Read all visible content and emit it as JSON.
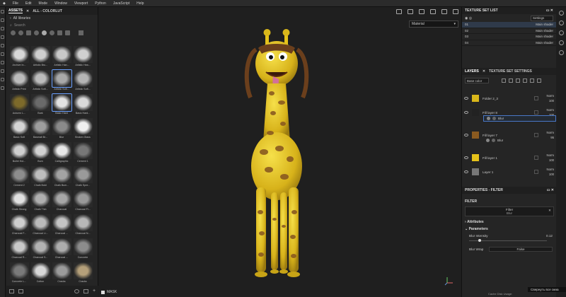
{
  "menu": [
    "File",
    "Edit",
    "Mode",
    "Window",
    "Viewport",
    "Python",
    "JavaScript",
    "Help"
  ],
  "assets": {
    "tab_assets": "ASSETS",
    "tab_close": "✕",
    "tab_colorlut": "ALL - COLORLUT",
    "library": "All libraries",
    "search_placeholder": "Search",
    "items": [
      {
        "label": "Archive In...",
        "sw": "#d8d8d8"
      },
      {
        "label": "Artistic Bru...",
        "sw": "#cfcfcf"
      },
      {
        "label": "Artistic Han...",
        "sw": "#c8c8c8"
      },
      {
        "label": "Artistic Hea...",
        "sw": "#d0d0d0"
      },
      {
        "label": "Artistic Print",
        "sw": "#bdbdbd"
      },
      {
        "label": "Artistic Soft...",
        "sw": "#bcbcbc"
      },
      {
        "label": "Artistic Soft...",
        "sw": "#a9a9a9",
        "sel": true
      },
      {
        "label": "Artistic Soft...",
        "sw": "#b5b5b5"
      },
      {
        "label": "Autumn L...",
        "sw": "#7d6a2a"
      },
      {
        "label": "Bark",
        "sw": "#6a6a6a"
      },
      {
        "label": "Basic Hard",
        "sw": "#e2e2e2",
        "sel": true
      },
      {
        "label": "Basic Hard...",
        "sw": "#d9d9d9"
      },
      {
        "label": "Basic Soft",
        "sw": "#d4d4d4"
      },
      {
        "label": "Basmati Br...",
        "sw": "#9e9e9e"
      },
      {
        "label": "Blur",
        "sw": "#8a8a8a"
      },
      {
        "label": "Broken Glass",
        "sw": "#efefef"
      },
      {
        "label": "Bullet Hol...",
        "sw": "#cfcfcf"
      },
      {
        "label": "Burn",
        "sw": "#d2d2d2"
      },
      {
        "label": "Calligraphic",
        "sw": "#e8e8e8"
      },
      {
        "label": "Cement 1",
        "sw": "#777777"
      },
      {
        "label": "Cement 2",
        "sw": "#8d8d8d"
      },
      {
        "label": "Chalk Bold",
        "sw": "#bdbdbd"
      },
      {
        "label": "Chalk Bum...",
        "sw": "#a3a3a3"
      },
      {
        "label": "Chalk Spre...",
        "sw": "#9a9a9a"
      },
      {
        "label": "Chalk Strong",
        "sw": "#e1e1e1"
      },
      {
        "label": "Chalk Thin",
        "sw": "#b0b0b0"
      },
      {
        "label": "Charcoal",
        "sw": "#a7a7a7"
      },
      {
        "label": "Charcoal Fi...",
        "sw": "#999999"
      },
      {
        "label": "Charcoal F...",
        "sw": "#cfcfcf"
      },
      {
        "label": "Charcoal Li...",
        "sw": "#bbbbbb"
      },
      {
        "label": "Charcoal ...",
        "sw": "#c4c4c4"
      },
      {
        "label": "Charcoal N...",
        "sw": "#b7b7b7"
      },
      {
        "label": "Charcoal R...",
        "sw": "#c9c9c9"
      },
      {
        "label": "Charcoal S...",
        "sw": "#b2b2b2"
      },
      {
        "label": "Charcoal ...",
        "sw": "#adadad"
      },
      {
        "label": "Concrete",
        "sw": "#8c8c8c"
      },
      {
        "label": "Concrete L...",
        "sw": "#7a7a7a"
      },
      {
        "label": "Cotton",
        "sw": "#d8d8d8"
      },
      {
        "label": "Cracks",
        "sw": "#9b9b9b"
      },
      {
        "label": "Cracks",
        "sw": "#b5a07a"
      }
    ]
  },
  "viewport": {
    "material_select": "Material",
    "mask_label": "MASK"
  },
  "texture_set_list": {
    "title": "TEXTURE SET LIST",
    "settings": "Settings",
    "rows": [
      {
        "name": "01",
        "shader": "Main shader",
        "sel": true
      },
      {
        "name": "02",
        "shader": "Main shader"
      },
      {
        "name": "03",
        "shader": "Main shader"
      },
      {
        "name": "04",
        "shader": "Main shader"
      }
    ]
  },
  "layers": {
    "tab_layers": "LAYERS",
    "tab_texture_set_settings": "TEXTURE SET SETTINGS",
    "base_color": "Base color",
    "items": [
      {
        "name": "Folder 2_3",
        "blend": "Norm",
        "opacity": "100",
        "thumb": "#d9b71a"
      },
      {
        "name": "Fill layer 8",
        "blend": "Norm",
        "opacity": "100",
        "thumb": "#222222"
      },
      {
        "name": "Fill layer 7",
        "blend": "Norm",
        "opacity": "95",
        "thumb": "#8a5a20"
      },
      {
        "name": "Fill layer 1",
        "blend": "Norm",
        "opacity": "100",
        "thumb": "#e5c21a"
      },
      {
        "name": "Layer 1",
        "blend": "Norm",
        "opacity": "100",
        "thumb": "#777777"
      }
    ],
    "sub_blur_1": "Blur",
    "sub_blur_2": "Blur"
  },
  "properties": {
    "title": "PROPERTIES - FILTER",
    "section_filter": "FILTER",
    "filter_name": "Filter",
    "filter_value": "Blur",
    "attributes": "Attributes",
    "parameters": "Parameters",
    "blur_intensity_label": "Blur Intensity",
    "blur_intensity_value": "0.12",
    "blur_intensity_fraction": 0.12,
    "blur_wrap_label": "Blur Wrap",
    "blur_wrap_value": "False"
  },
  "status": {
    "tooltip": "Свернуть все окна",
    "cache": "Cache Disk Usage:"
  }
}
